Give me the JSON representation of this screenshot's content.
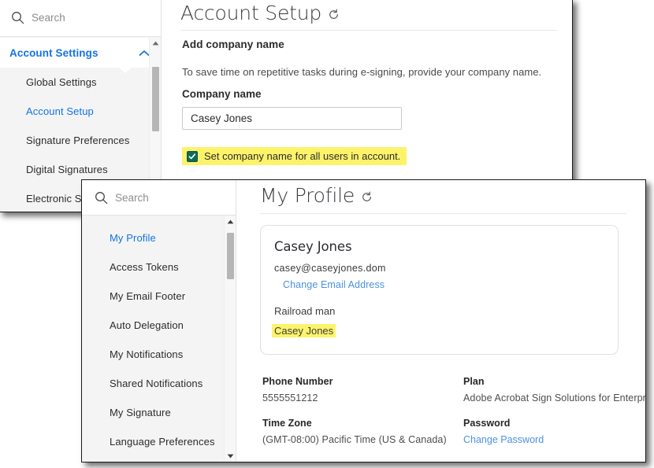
{
  "account_panel": {
    "search": {
      "placeholder": "Search",
      "value": "",
      "icon": "search-icon"
    },
    "nav": {
      "group_label": "Account Settings",
      "group_icon": "chevron-up-icon",
      "items": [
        {
          "label": "Global Settings",
          "selected": false
        },
        {
          "label": "Account Setup",
          "selected": true
        },
        {
          "label": "Signature Preferences",
          "selected": false
        },
        {
          "label": "Digital Signatures",
          "selected": false
        },
        {
          "label": "Electronic S",
          "selected": false
        }
      ]
    },
    "title": "Account Setup",
    "title_icon": "refresh-icon",
    "section_heading": "Add company name",
    "description": "To save time on repetitive tasks during e-signing, provide your company name.",
    "field_label": "Company name",
    "field_value": "Casey Jones",
    "checkbox": {
      "checked": true,
      "label": "Set company name for all users in account.",
      "highlight_color": "#fdf36b",
      "box_color": "#0e6b5a"
    }
  },
  "profile_panel": {
    "search": {
      "placeholder": "Search",
      "value": "",
      "icon": "search-icon"
    },
    "nav": {
      "items": [
        {
          "label": "My Profile",
          "selected": true
        },
        {
          "label": "Access Tokens",
          "selected": false
        },
        {
          "label": "My Email Footer",
          "selected": false
        },
        {
          "label": "Auto Delegation",
          "selected": false
        },
        {
          "label": "My Notifications",
          "selected": false
        },
        {
          "label": "Shared Notifications",
          "selected": false
        },
        {
          "label": "My Signature",
          "selected": false
        },
        {
          "label": "Language Preferences",
          "selected": false
        }
      ]
    },
    "title": "My Profile",
    "title_icon": "refresh-icon",
    "card": {
      "name": "Casey Jones",
      "email": "casey@caseyjones.dom",
      "change_email_link": "Change Email Address",
      "job_title": "Railroad man",
      "company": "Casey Jones",
      "company_highlighted": true
    },
    "details": [
      {
        "label": "Phone Number",
        "value": "5555551212",
        "type": "text"
      },
      {
        "label": "Plan",
        "value": "Adobe Acrobat Sign Solutions for Enterprise",
        "type": "text"
      },
      {
        "label": "Time Zone",
        "value": "(GMT-08:00) Pacific Time (US & Canada)",
        "type": "text"
      },
      {
        "label": "Password",
        "value": "Change Password",
        "type": "link"
      }
    ]
  },
  "colors": {
    "accent_blue": "#1473e6",
    "link_blue": "#4b91e2",
    "highlight_yellow": "#fdf36b",
    "checkbox_green": "#0e6b5a"
  }
}
